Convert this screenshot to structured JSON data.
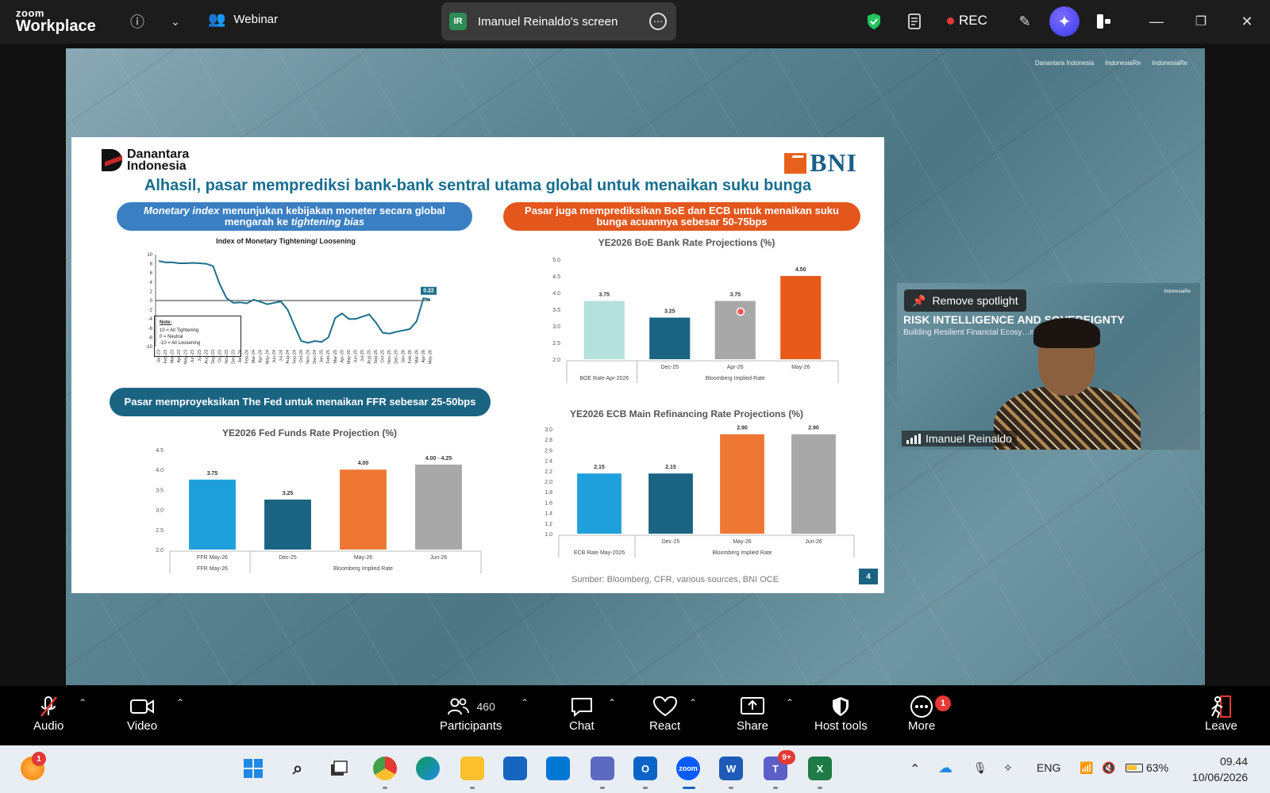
{
  "titlebar": {
    "logo_line1": "zoom",
    "logo_line2": "Workplace",
    "webinar_label": "Webinar",
    "screen_badge": "IR",
    "screen_label": "Imanuel Reinaldo's screen",
    "rec_label": "REC"
  },
  "share": {
    "brand_top": [
      "Danantara Indonesia",
      "IndonesiaRe",
      "IndonesiaRe"
    ]
  },
  "slide": {
    "logo_left": "Danantara Indonesia",
    "logo_right": "BNI",
    "title": "Alhasil, pasar memprediksi bank-bank sentral utama global untuk menaikan suku bunga",
    "pill_monetary_italic": "Monetary index",
    "pill_monetary_rest1": " menunjukan kebijakan moneter secara global mengarah ke ",
    "pill_monetary_italic2": "tightening bias",
    "pill_boe": "Pasar juga memprediksikan BoE dan ECB untuk menaikan suku bunga acuannya sebesar 50-75bps",
    "pill_fed": "Pasar memproyeksikan The Fed untuk menaikan FFR sebesar 25-50bps",
    "note_title": "Note:",
    "note_lines": [
      "10  = All Tightening",
      "0   = Neutral",
      "-10 = All Loosening"
    ],
    "source": "Sumber: Bloomberg, CFR, various sources, BNI OCE",
    "page_number": "4"
  },
  "chart_data": [
    {
      "type": "line",
      "title": "Index of Monetary Tightening/ Loosening",
      "ylim": [
        -10,
        10
      ],
      "yticks": [
        10,
        8,
        6,
        4,
        2,
        0,
        -2,
        -4,
        -6,
        -8,
        -10
      ],
      "x": [
        "Jan-23",
        "Feb-23",
        "Mar-23",
        "Apr-23",
        "May-23",
        "Jun-23",
        "Jul-23",
        "Aug-23",
        "Sep-23",
        "Oct-23",
        "Nov-23",
        "Dec-23",
        "Jan-24",
        "Feb-24",
        "Mar-24",
        "Apr-24",
        "May-24",
        "Jun-24",
        "Jul-24",
        "Aug-24",
        "Sep-24",
        "Oct-24",
        "Nov-24",
        "Dec-24",
        "Jan-25",
        "Feb-25",
        "Mar-25",
        "Apr-25",
        "May-25",
        "Jun-25",
        "Jul-25",
        "Aug-25",
        "Sep-25",
        "Oct-25",
        "Nov-25",
        "Dec-25",
        "Jan-26",
        "Feb-26",
        "Mar-26",
        "Apr-26",
        "May-26"
      ],
      "y": [
        8.6,
        8.3,
        8.3,
        8.1,
        8.1,
        8.2,
        8.1,
        8.0,
        7.5,
        3.5,
        0.5,
        -0.5,
        -0.4,
        -0.6,
        0.2,
        -0.3,
        -0.8,
        -0.5,
        -0.2,
        -2.0,
        -5.5,
        -8.8,
        -9.2,
        -8.8,
        -9.0,
        -8.0,
        -3.8,
        -2.8,
        -4.0,
        -4.0,
        -3.5,
        -3.0,
        -4.8,
        -7.0,
        -7.2,
        -6.8,
        -6.5,
        -6.2,
        -4.5,
        0.5,
        0.22
      ],
      "annotation": "0.22",
      "grid": false
    },
    {
      "type": "bar",
      "title": "YE2026 BoE Bank Rate Projections (%)",
      "categories": [
        "",
        "Dec-25",
        "Apr-26",
        "May-26"
      ],
      "group_labels": [
        "BOE Rate Apr-2026",
        "Bloomberg Implied Rate"
      ],
      "values": [
        3.75,
        3.25,
        3.75,
        4.5
      ],
      "value_labels": [
        "3.75",
        "3.25",
        "3.75",
        "4.50"
      ],
      "colors": [
        "#b5e1dc",
        "#1a6482",
        "#a8a8a8",
        "#e85a1a"
      ],
      "ylim": [
        2.0,
        5.0
      ],
      "yticks": [
        5.0,
        4.5,
        4.0,
        3.5,
        3.0,
        2.5,
        2.0
      ]
    },
    {
      "type": "bar",
      "title": "YE2026 Fed Funds Rate Projection (%)",
      "categories": [
        "FFR May-26",
        "Dec-25",
        "May-26",
        "Jun-26"
      ],
      "group_labels": [
        "Bloomberg Implied Rate"
      ],
      "values": [
        3.75,
        3.25,
        4.0,
        4.125
      ],
      "value_labels": [
        "3.75",
        "3.25",
        "4.00",
        "4.00 - 4.25"
      ],
      "colors": [
        "#1fa0dc",
        "#1a6482",
        "#ee7733",
        "#a8a8a8"
      ],
      "ylim": [
        2.0,
        4.5
      ],
      "yticks": [
        4.5,
        4.0,
        3.5,
        3.0,
        2.5,
        2.0
      ]
    },
    {
      "type": "bar",
      "title": "YE2026 ECB Main Refinancing Rate Projections (%)",
      "categories": [
        "",
        "Dec-25",
        "May-26",
        "Jun-26"
      ],
      "group_labels": [
        "ECB Rate May-2026",
        "Bloomberg Implied Rate"
      ],
      "values": [
        2.15,
        2.15,
        2.9,
        2.9
      ],
      "value_labels": [
        "2.15",
        "2.15",
        "2.90",
        "2.90"
      ],
      "colors": [
        "#1fa0dc",
        "#1a6482",
        "#ee7733",
        "#a8a8a8"
      ],
      "ylim": [
        1.0,
        3.0
      ],
      "yticks": [
        3.0,
        2.8,
        2.6,
        2.4,
        2.2,
        2.0,
        1.8,
        1.6,
        1.4,
        1.2,
        1.0
      ]
    }
  ],
  "speaker": {
    "remove_spotlight": "Remove spotlight",
    "banner_title": "RISK INTELLIGENCE AND SOVEREIGNTY",
    "banner_sub": "Building Resilient Financial Ecosy…n Uncertain World",
    "name": "Imanuel Reinaldo"
  },
  "controls": {
    "audio": "Audio",
    "video": "Video",
    "participants": "Participants",
    "participants_count": "460",
    "chat": "Chat",
    "react": "React",
    "share": "Share",
    "host_tools": "Host tools",
    "more": "More",
    "more_badge": "1",
    "leave": "Leave"
  },
  "taskbar": {
    "notif_badge": "1",
    "teams_badge": "9+",
    "lang": "ENG",
    "battery": "63%",
    "time": "09.44",
    "date": "10/06/2026"
  }
}
